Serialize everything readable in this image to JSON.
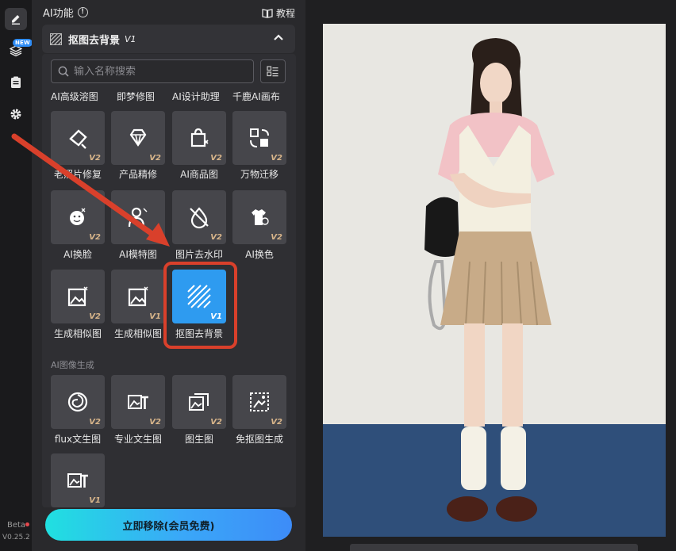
{
  "rail": {
    "items": [
      {
        "icon": "edit-icon"
      },
      {
        "icon": "layers-icon",
        "badge": "NEW"
      },
      {
        "icon": "clipboard-icon"
      },
      {
        "icon": "gear-icon"
      }
    ],
    "beta_label": "Beta",
    "version": "V0.25.2"
  },
  "panel": {
    "title": "AI功能",
    "tutorial_label": "教程",
    "section": {
      "label": "抠图去背景",
      "version": "V1"
    },
    "search": {
      "placeholder": "输入名称搜索"
    },
    "top_row_labels": [
      "AI高级溶图",
      "即梦修图",
      "AI设计助理",
      "千鹿AI画布"
    ],
    "tools": [
      {
        "label": "老照片修复",
        "version": "V2",
        "icon": "eraser-icon"
      },
      {
        "label": "产品精修",
        "version": "V2",
        "icon": "diamond-icon"
      },
      {
        "label": "AI商品图",
        "version": "V2",
        "icon": "shopping-bag-icon"
      },
      {
        "label": "万物迁移",
        "version": "V2",
        "icon": "transfer-icon"
      },
      {
        "label": "AI换脸",
        "version": "V2",
        "icon": "face-swap-icon"
      },
      {
        "label": "AI模特图",
        "version": "V2",
        "icon": "model-icon"
      },
      {
        "label": "图片去水印",
        "version": "V2",
        "icon": "watermark-remove-icon"
      },
      {
        "label": "AI换色",
        "version": "V2",
        "icon": "recolor-icon"
      },
      {
        "label": "生成相似图",
        "version": "V2",
        "icon": "similar-image-icon"
      },
      {
        "label": "生成相似图",
        "version": "V1",
        "icon": "similar-image-icon"
      },
      {
        "label": "抠图去背景",
        "version": "V1",
        "icon": "remove-background-icon"
      }
    ],
    "subsection_title": "AI图像生成",
    "gen_tools": [
      {
        "label": "flux文生图",
        "version": "V2",
        "icon": "flux-icon"
      },
      {
        "label": "专业文生图",
        "version": "V2",
        "icon": "text-to-image-icon"
      },
      {
        "label": "图生图",
        "version": "V2",
        "icon": "image-to-image-icon"
      },
      {
        "label": "免抠图生成",
        "version": "V2",
        "icon": "cutout-free-icon"
      },
      {
        "label": "",
        "version": "V1",
        "icon": "text-to-image-icon"
      }
    ],
    "cta_label": "立即移除(会员免费)"
  },
  "colors": {
    "accent": "#2e9bf0",
    "highlight": "#d9402b",
    "version_tag": "#d8b58a"
  }
}
